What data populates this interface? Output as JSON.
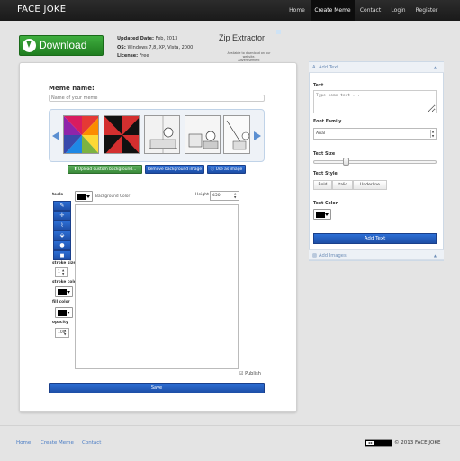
{
  "navbar": {
    "brand": "FACE JOKE",
    "items": [
      {
        "label": "Home"
      },
      {
        "label": "Create Meme"
      },
      {
        "label": "Contact"
      },
      {
        "label": "Login"
      },
      {
        "label": "Register"
      }
    ],
    "active_item": "Create Meme"
  },
  "ad": {
    "button_label": "Download",
    "updated": {
      "label": "Updated Date:",
      "value": "Feb, 2013"
    },
    "os": {
      "label": "OS:",
      "value": "Windows 7,8, XP, Vista, 2000"
    },
    "license": {
      "label": "License:",
      "value": "Free"
    },
    "title": "Zip Extractor",
    "small_line1": "Available to download on our website.",
    "small_line2": "Advertisement"
  },
  "editor": {
    "meme_name_label": "Meme name:",
    "meme_name_placeholder": "Name of your meme",
    "buttons": {
      "upload": "Upload custom background...",
      "remove": "Remove background image",
      "use": "Use as image"
    },
    "tools_label": "tools",
    "tool_icons": [
      "pencil-icon",
      "move-icon",
      "brush-icon",
      "bucket-icon",
      "circle-icon",
      "square-icon"
    ],
    "stroke_size_label": "stroke size",
    "stroke_size_value": "1",
    "stroke_color_label": "stroke color",
    "fill_color_label": "fill color",
    "opacity_label": "opacity",
    "opacity_value": "100",
    "background_color_label": "Background Color",
    "height_label": "Height",
    "height_value": "450",
    "publish_label": "Publish",
    "save_label": "Save"
  },
  "right_panel": {
    "add_text_header": "Add Text",
    "text_label": "Text",
    "text_placeholder": "Type some text ...",
    "font_family_label": "Font Family",
    "font_family_value": "Arial",
    "text_size_label": "Text Size",
    "text_size_fraction": 0.27,
    "text_style_label": "Text Style",
    "style_buttons": [
      "Bold",
      "Italic",
      "Underline"
    ],
    "text_color_label": "Text Color",
    "add_text_button": "Add Text",
    "add_images_header": "Add Images"
  },
  "footer": {
    "links": [
      "Home",
      "Create Meme",
      "Contact"
    ],
    "cc_label": "cc",
    "copyright": "© 2013 FACE JOKE"
  },
  "colors": {
    "primary_blue": "#1f4fa8",
    "green": "#3a8a3a",
    "navbar": "#1a1a1a",
    "link": "#4a7cc4"
  }
}
